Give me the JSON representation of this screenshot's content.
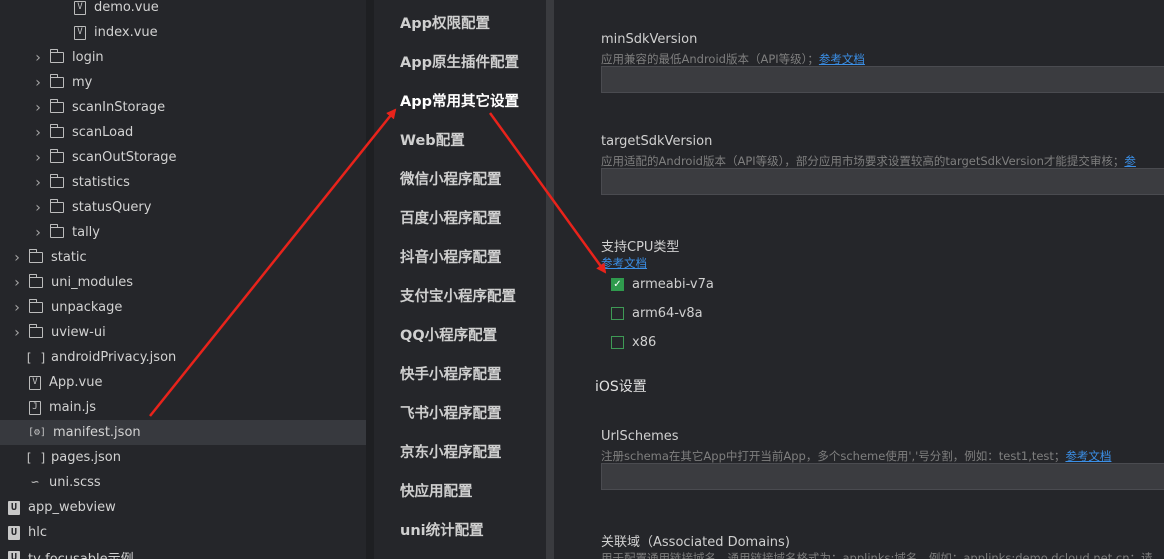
{
  "tree": [
    {
      "label": "demo.vue",
      "type": "vue",
      "depth": 3,
      "expandable": false
    },
    {
      "label": "index.vue",
      "type": "vue",
      "depth": 3,
      "expandable": false
    },
    {
      "label": "login",
      "type": "folder",
      "depth": 2,
      "expandable": true
    },
    {
      "label": "my",
      "type": "folder",
      "depth": 2,
      "expandable": true
    },
    {
      "label": "scanInStorage",
      "type": "folder",
      "depth": 2,
      "expandable": true
    },
    {
      "label": "scanLoad",
      "type": "folder",
      "depth": 2,
      "expandable": true
    },
    {
      "label": "scanOutStorage",
      "type": "folder",
      "depth": 2,
      "expandable": true
    },
    {
      "label": "statistics",
      "type": "folder",
      "depth": 2,
      "expandable": true
    },
    {
      "label": "statusQuery",
      "type": "folder",
      "depth": 2,
      "expandable": true
    },
    {
      "label": "tally",
      "type": "folder",
      "depth": 2,
      "expandable": true
    },
    {
      "label": "static",
      "type": "folder",
      "depth": 1,
      "expandable": true
    },
    {
      "label": "uni_modules",
      "type": "folder",
      "depth": 1,
      "expandable": true
    },
    {
      "label": "unpackage",
      "type": "folder",
      "depth": 1,
      "expandable": true
    },
    {
      "label": "uview-ui",
      "type": "folder",
      "depth": 1,
      "expandable": true
    },
    {
      "label": "androidPrivacy.json",
      "type": "json",
      "depth": 1,
      "expandable": false
    },
    {
      "label": "App.vue",
      "type": "vue",
      "depth": 1,
      "expandable": false
    },
    {
      "label": "main.js",
      "type": "js",
      "depth": 1,
      "expandable": false
    },
    {
      "label": "manifest.json",
      "type": "manifest",
      "depth": 1,
      "expandable": false,
      "selected": true
    },
    {
      "label": "pages.json",
      "type": "json",
      "depth": 1,
      "expandable": false
    },
    {
      "label": "uni.scss",
      "type": "sass",
      "depth": 1,
      "expandable": false
    },
    {
      "label": "app_webview",
      "type": "project",
      "depth": 0,
      "expandable": false
    },
    {
      "label": "hlc",
      "type": "project",
      "depth": 0,
      "expandable": false
    },
    {
      "label": "tv-focusable示例",
      "type": "project",
      "depth": 0,
      "expandable": false
    }
  ],
  "nav": [
    {
      "label": "App权限配置"
    },
    {
      "label": "App原生插件配置"
    },
    {
      "label": "App常用其它设置",
      "active": true
    },
    {
      "label": "Web配置"
    },
    {
      "label": "微信小程序配置"
    },
    {
      "label": "百度小程序配置"
    },
    {
      "label": "抖音小程序配置"
    },
    {
      "label": "支付宝小程序配置"
    },
    {
      "label": "QQ小程序配置"
    },
    {
      "label": "快手小程序配置"
    },
    {
      "label": "飞书小程序配置"
    },
    {
      "label": "京东小程序配置"
    },
    {
      "label": "快应用配置"
    },
    {
      "label": "uni统计配置"
    }
  ],
  "content": {
    "min_sdk": {
      "label": "minSdkVersion",
      "desc": "应用兼容的最低Android版本（API等级）；",
      "link": "参考文档",
      "value": ""
    },
    "target_sdk": {
      "label": "targetSdkVersion",
      "desc": "应用适配的Android版本（API等级），部分应用市场要求设置较高的targetSdkVersion才能提交审核；",
      "link": "参",
      "value": ""
    },
    "cpu": {
      "label": "支持CPU类型",
      "link": "参考文档",
      "options": [
        {
          "label": "armeabi-v7a",
          "checked": true
        },
        {
          "label": "arm64-v8a",
          "checked": false
        },
        {
          "label": "x86",
          "checked": false
        }
      ]
    },
    "ios_title": "iOS设置",
    "url_schemes": {
      "label": "UrlSchemes",
      "desc": "注册schema在其它App中打开当前App，多个scheme使用','号分割，例如：test1,test；",
      "link": "参考文档",
      "value": ""
    },
    "associated": {
      "label": "关联域（Associated Domains)",
      "desc": "用于配置通用链接域名，通用链接域名格式为：applinks:域名，例如：applinks:demo.dcloud.net.cn；请"
    }
  },
  "colors": {
    "arrow": "#e8231b",
    "link": "#3b8fe6",
    "checkbox": "#2f9a4d"
  }
}
